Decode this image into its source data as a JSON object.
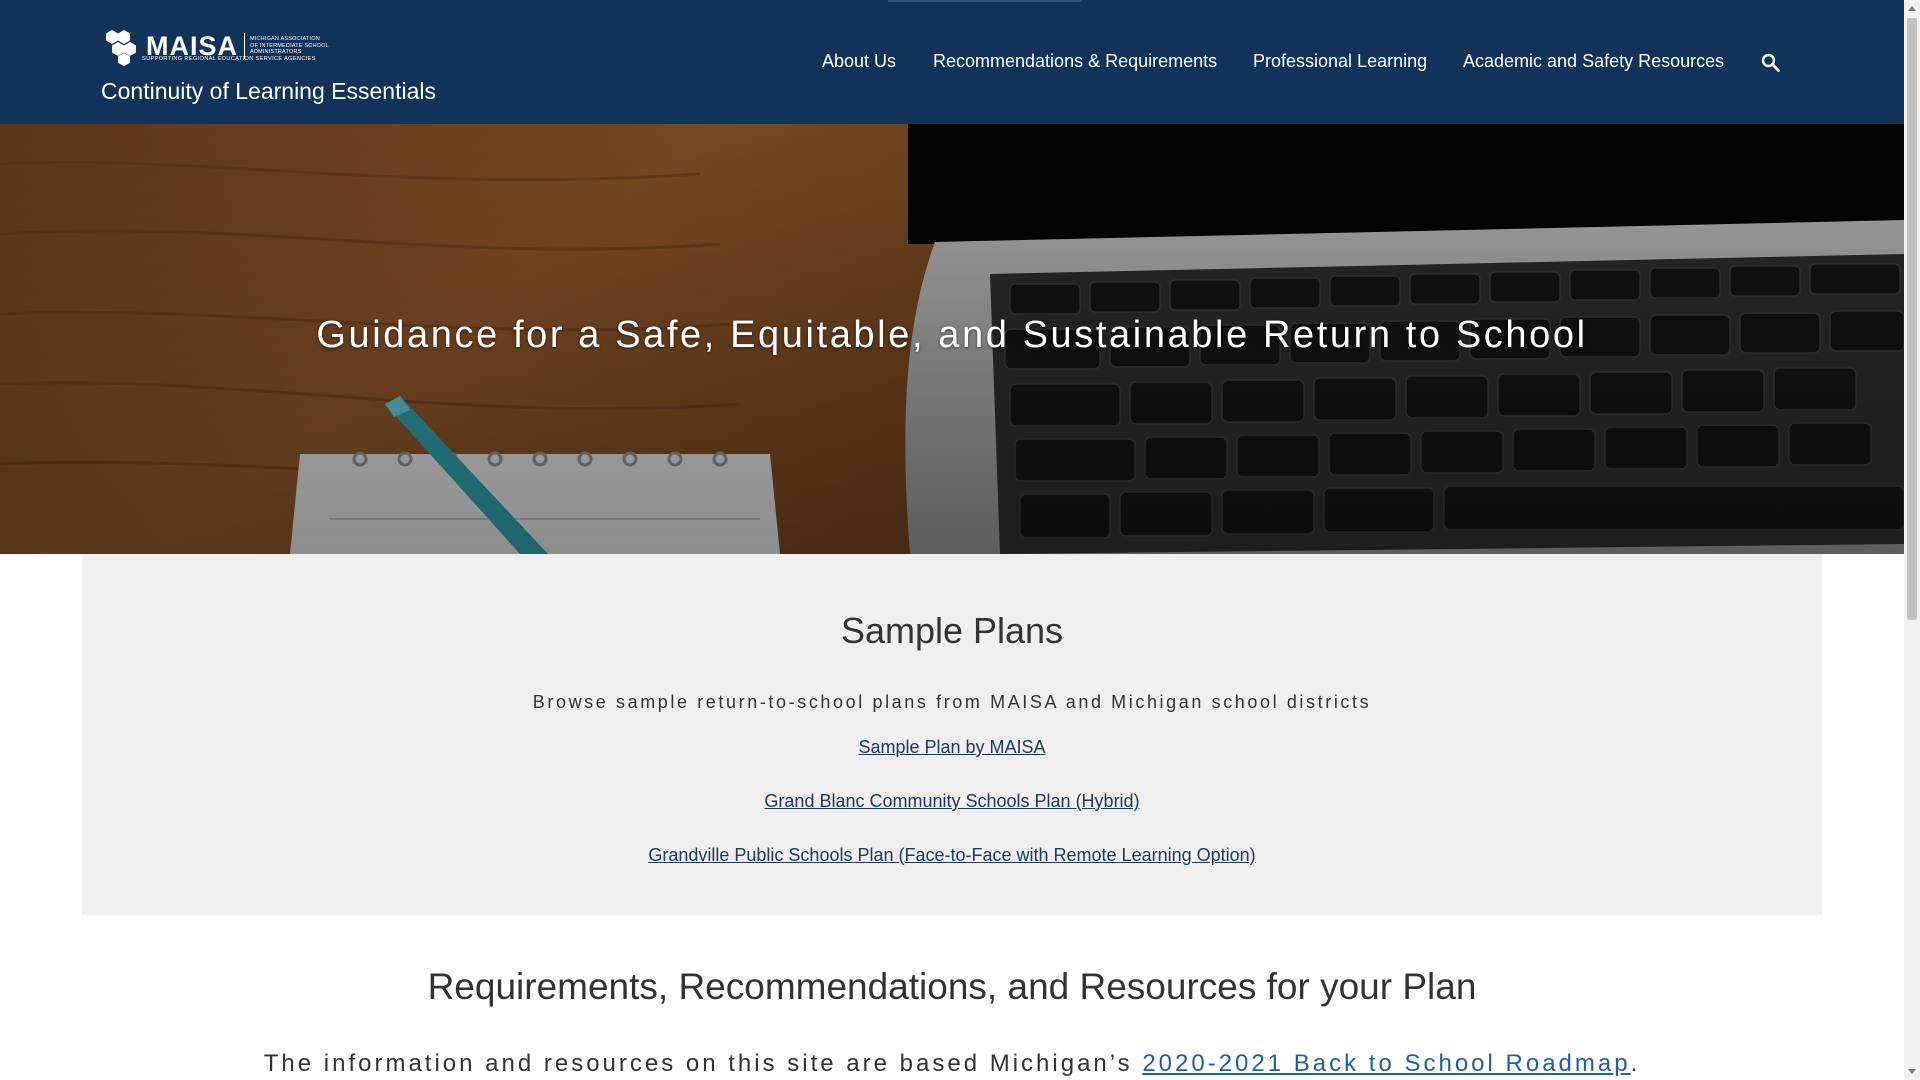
{
  "header": {
    "logo_text": "MAISA",
    "logo_small_lines": [
      "Michigan Association",
      "of Intermediate School",
      "Administrators"
    ],
    "logo_tagline": "Supporting Regional Education Service Agencies",
    "site_title": "Continuity of Learning Essentials",
    "nav": [
      {
        "label": "About Us"
      },
      {
        "label": "Recommendations & Requirements"
      },
      {
        "label": "Professional Learning"
      },
      {
        "label": "Academic and Safety Resources"
      }
    ],
    "search_icon": "search-icon",
    "colors": {
      "header_bg": "#11335a",
      "text": "#ffffff"
    }
  },
  "hero": {
    "title": "Guidance for a Safe, Equitable, and Sustainable Return to School"
  },
  "sample_plans": {
    "heading": "Sample Plans",
    "subtitle": "Browse sample return-to-school plans from MAISA and Michigan school districts",
    "links": [
      {
        "label": "Sample Plan by MAISA"
      },
      {
        "label": "Grand Blanc Community Schools Plan (Hybrid)"
      },
      {
        "label": "Grandville Public Schools Plan (Face-to-Face with Remote Learning Option)"
      }
    ],
    "colors": {
      "bg": "#efefef",
      "link": "#1c3a63"
    }
  },
  "requirements": {
    "heading": "Requirements, Recommendations, and Resources for your Plan",
    "text_before": "The information and resources on this site are based Michigan’s ",
    "link_label": "2020-2021 Back to School Roadmap",
    "text_after": "."
  }
}
